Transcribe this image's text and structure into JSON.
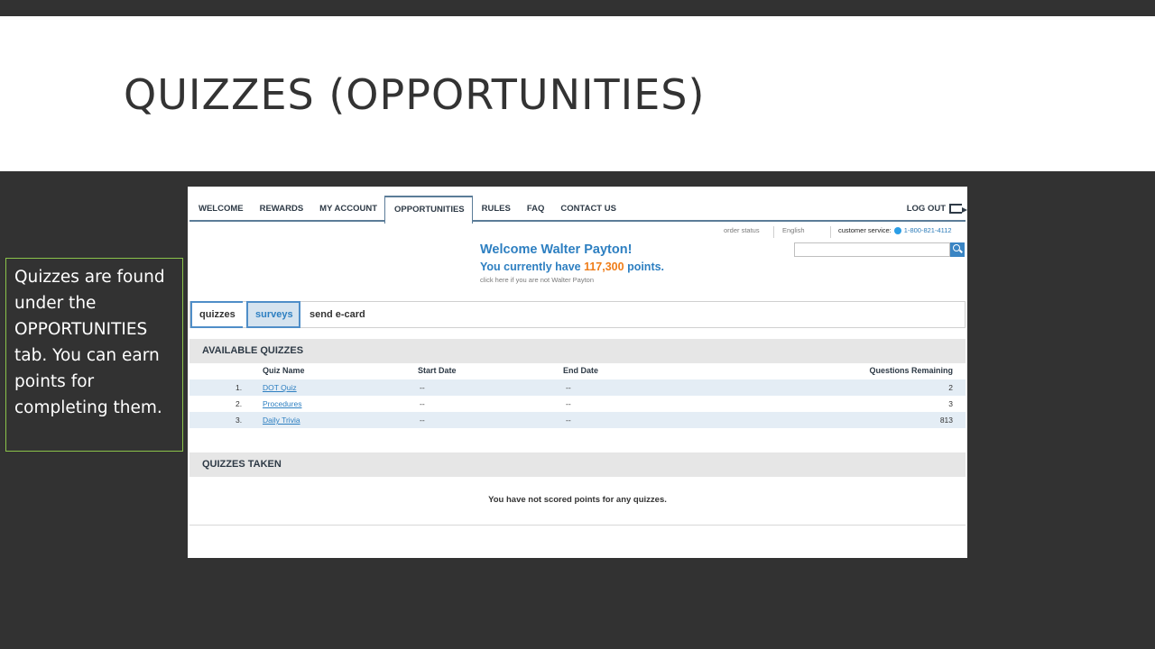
{
  "slide": {
    "title": "QUIZZES (OPPORTUNITIES)",
    "callout": "Quizzes are found under the OPPORTUNITIES tab. You can earn points for completing them."
  },
  "nav": {
    "tabs": [
      "WELCOME",
      "REWARDS",
      "MY ACCOUNT",
      "OPPORTUNITIES",
      "RULES",
      "FAQ",
      "CONTACT US"
    ],
    "active_tab": "OPPORTUNITIES",
    "logout": "LOG OUT"
  },
  "utility": {
    "order_status": "order status",
    "language": "English",
    "customer_service": "customer service:",
    "phone": "1-800-821-4112"
  },
  "welcome": {
    "greeting": "Welcome Walter Payton!",
    "points_prefix": "You currently have ",
    "points": "117,300",
    "points_suffix": " points.",
    "not_me": "click here if you are not Walter Payton"
  },
  "subtabs": [
    "quizzes",
    "surveys",
    "send e-card"
  ],
  "available": {
    "header": "AVAILABLE QUIZZES",
    "columns": [
      "Quiz Name",
      "Start Date",
      "End Date",
      "Questions Remaining"
    ],
    "rows": [
      {
        "num": "1.",
        "name": "DOT Quiz",
        "start": "--",
        "end": "--",
        "remaining": "2"
      },
      {
        "num": "2.",
        "name": "Procedures",
        "start": "--",
        "end": "--",
        "remaining": "3"
      },
      {
        "num": "3.",
        "name": "Daily Trivia",
        "start": "--",
        "end": "--",
        "remaining": "813"
      }
    ]
  },
  "taken": {
    "header": "QUIZZES TAKEN",
    "empty_message": "You have not scored points for any quizzes."
  },
  "colors": {
    "accent_blue": "#2d7fc1",
    "points_orange": "#ef7d19",
    "callout_border": "#8bc34a",
    "slide_bg": "#323232"
  }
}
